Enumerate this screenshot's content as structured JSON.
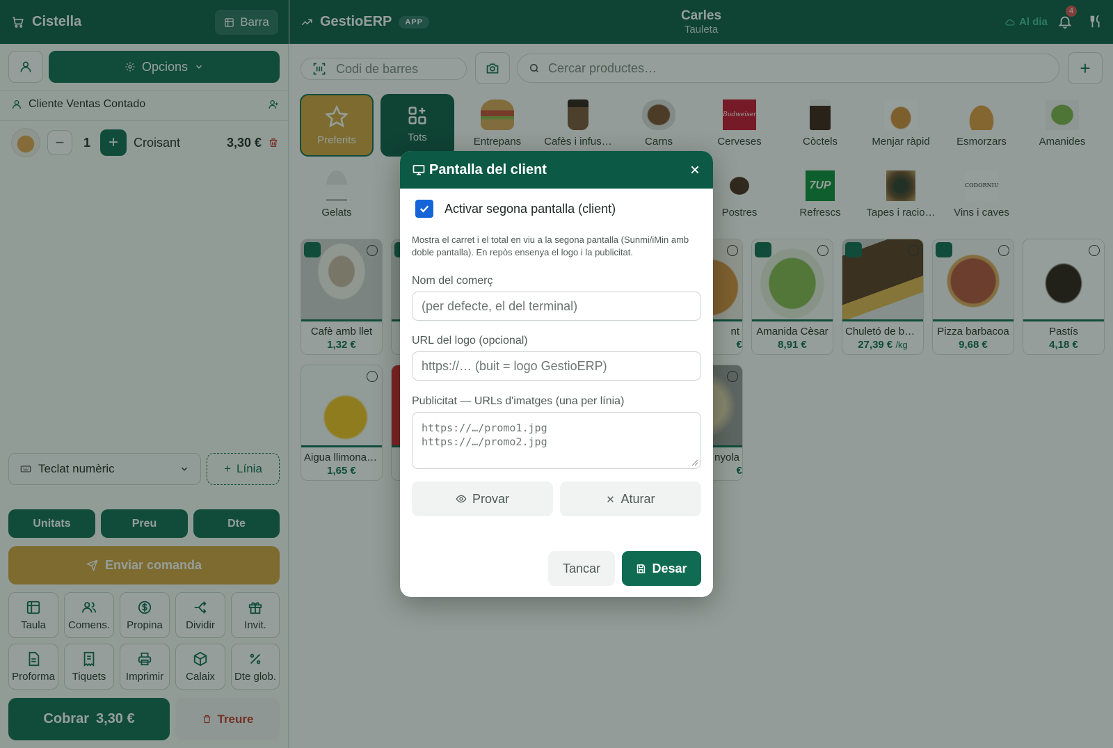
{
  "cart": {
    "title": "Cistella",
    "barra_label": "Barra",
    "options_label": "Opcions",
    "client_name": "Cliente Ventas Contado",
    "items": [
      {
        "qty": "1",
        "name": "Croisant",
        "price": "3,30 €"
      }
    ],
    "keypad_select": "Teclat numèric",
    "line_label": "Línia",
    "mode_buttons": [
      "Unitats",
      "Preu",
      "Dte"
    ],
    "send_order": "Enviar comanda",
    "tools": [
      {
        "label": "Taula",
        "icon": "table-icon"
      },
      {
        "label": "Comens.",
        "icon": "users-icon"
      },
      {
        "label": "Propina",
        "icon": "dollar-icon"
      },
      {
        "label": "Dividir",
        "icon": "split-icon"
      },
      {
        "label": "Invit.",
        "icon": "gift-icon"
      },
      {
        "label": "Proforma",
        "icon": "document-icon"
      },
      {
        "label": "Tiquets",
        "icon": "receipt-icon"
      },
      {
        "label": "Imprimir",
        "icon": "printer-icon"
      },
      {
        "label": "Calaix",
        "icon": "box-icon"
      },
      {
        "label": "Dte glob.",
        "icon": "percent-icon"
      }
    ],
    "charge_label": "Cobrar",
    "charge_amount": "3,30 €",
    "remove_label": "Treure"
  },
  "header": {
    "app_name": "GestioERP",
    "app_badge": "APP",
    "user_name": "Carles",
    "terminal": "Tauleta",
    "sync_status": "Al dia",
    "notifications": "4"
  },
  "search": {
    "barcode_placeholder": "Codi de barres",
    "product_placeholder": "Cercar productes…"
  },
  "categories_row1": [
    "Preferits",
    "Tots",
    "Entrepans",
    "Cafès i infus…",
    "Carns",
    "Cerveses",
    "Còctels",
    "Menjar ràpid",
    "Esmorzars",
    "Amanides"
  ],
  "categories_row2": [
    "Gelats",
    "Postres",
    "Refrescs",
    "Tapes i racio…",
    "Vins i caves"
  ],
  "products": [
    {
      "name": "Cafè amb llet",
      "price": "1,32 €"
    },
    {
      "name": "nt",
      "price": "€"
    },
    {
      "name": "Amanida Cèsar",
      "price": "8,91 €"
    },
    {
      "name": "Chuletó de bo…",
      "price": "27,39 €",
      "unit": "/kg"
    },
    {
      "name": "Pizza barbacoa",
      "price": "9,68 €"
    },
    {
      "name": "Pastís",
      "price": "4,18 €"
    },
    {
      "name": "Aigua llimona …",
      "price": "1,65 €"
    },
    {
      "name": "nyola",
      "price": "€"
    }
  ],
  "modal": {
    "title": "Pantalla del client",
    "checkbox_label": "Activar segona pantalla (client)",
    "description": "Mostra el carret i el total en viu a la segona pantalla (Sunmi/iMin amb doble pantalla). En repòs ensenya el logo i la publicitat.",
    "shop_name_label": "Nom del comerç",
    "shop_name_placeholder": "(per defecte, el del terminal)",
    "logo_label": "URL del logo (opcional)",
    "logo_placeholder": "https://… (buit = logo GestioERP)",
    "ads_label": "Publicitat — URLs d'imatges (una per línia)",
    "ads_placeholder": "https://…/promo1.jpg\nhttps://…/promo2.jpg",
    "test_label": "Provar",
    "stop_label": "Aturar",
    "close_label": "Tancar",
    "save_label": "Desar"
  },
  "colors": {
    "brand": "#0c5a45",
    "primary": "#0f6b52",
    "gold": "#d4a23c",
    "danger": "#c0392b"
  }
}
